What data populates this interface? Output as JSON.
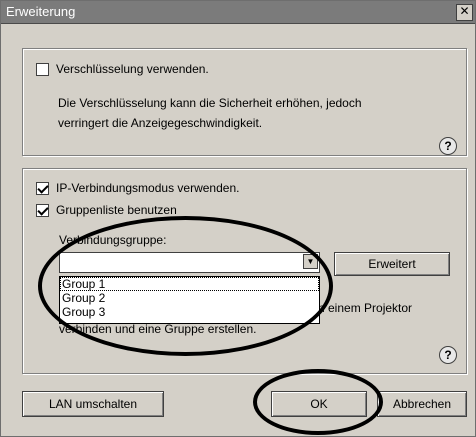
{
  "window": {
    "title": "Erweiterung",
    "close_glyph": "✕"
  },
  "encryption": {
    "checkbox_label": "Verschlüsselung verwenden.",
    "checked": false,
    "description_line1": "Die Verschlüsselung kann die Sicherheit erhöhen, jedoch",
    "description_line2": "verringert die Anzeigegeschwindigkeit.",
    "help_icon": "question-icon",
    "help_glyph": "?"
  },
  "ip_mode": {
    "checkbox_label": "IP-Verbindungsmodus verwenden.",
    "checked": true,
    "group_list_label": "Gruppenliste benutzen",
    "group_list_checked": true,
    "connection_group_label": "Verbindungsgruppe:",
    "select_value": "",
    "dropdown_options": [
      "Group 1",
      "Group 2",
      "Group 3"
    ],
    "selected_option": "Group 1",
    "advanced_button": "Erweitert",
    "partial_text_line1": "n einem Projektor",
    "partial_text_line2": "verbinden und eine Gruppe erstellen.",
    "help_glyph": "?"
  },
  "footer": {
    "lan_button": "LAN umschalten",
    "ok_button": "OK",
    "cancel_button": "Abbrechen"
  }
}
